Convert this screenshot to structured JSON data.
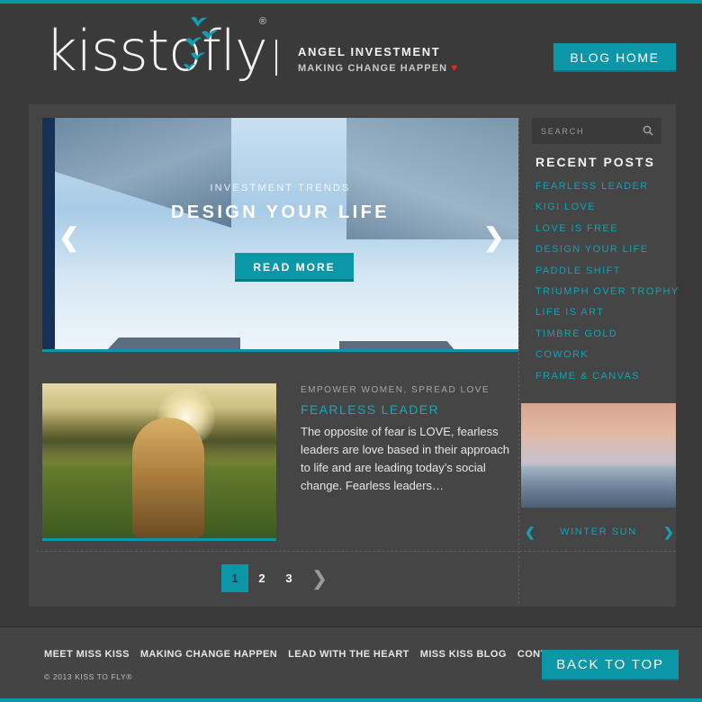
{
  "header": {
    "logo_text": "kisstofly",
    "logo_mark": "®",
    "tagline_primary": "ANGEL INVESTMENT",
    "tagline_secondary": "MAKING CHANGE HAPPEN",
    "heart_icon": "heart-icon",
    "blog_home_label": "BLOG HOME"
  },
  "slider": {
    "kicker": "INVESTMENT TRENDS",
    "title": "DESIGN YOUR LIFE",
    "cta_label": "READ MORE",
    "prev_icon": "chevron-left-icon",
    "next_icon": "chevron-right-icon"
  },
  "article": {
    "meta": "EMPOWER WOMEN, SPREAD LOVE",
    "title": "FEARLESS LEADER",
    "excerpt": "The opposite of fear is LOVE, fearless leaders are love based in their approach to life and are leading today’s social change. Fearless leaders…"
  },
  "pagination": {
    "pages": [
      "1",
      "2",
      "3"
    ],
    "current": "1",
    "next_icon": "chevron-right-icon"
  },
  "sidebar": {
    "search_placeholder": "SEARCH",
    "recent_title": "RECENT POSTS",
    "recent_posts": [
      "FEARLESS LEADER",
      "KIGI LOVE",
      "LOVE IS FREE",
      "DESIGN YOUR LIFE",
      "PADDLE SHIFT",
      "TRIUMPH OVER TROPHY",
      "LIFE IS ART",
      "TIMBRE GOLD",
      "COWORK",
      "FRAME & CANVAS"
    ],
    "carousel_caption": "WINTER SUN"
  },
  "footer": {
    "nav": [
      "MEET MISS KISS",
      "MAKING CHANGE HAPPEN",
      "LEAD WITH THE HEART",
      "MISS KISS BLOG",
      "CONTACT"
    ],
    "copyright": "© 2013 KISS TO FLY®",
    "back_to_top_label": "BACK TO TOP"
  },
  "colors": {
    "accent": "#0c97a8",
    "link": "#0ea3b6",
    "background": "#3a3a3a",
    "panel": "#454545",
    "heart": "#e4262b"
  }
}
